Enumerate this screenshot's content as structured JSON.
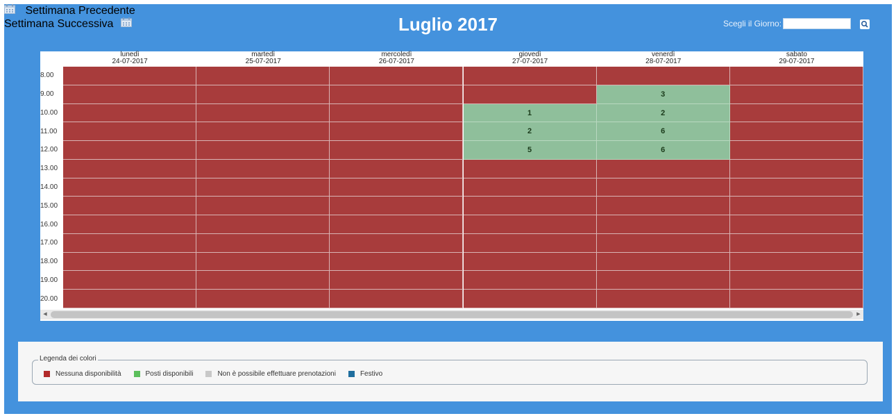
{
  "header": {
    "prev_label": "Settimana Precedente",
    "next_label": "Settimana Successiva",
    "month_title": "Luglio 2017",
    "day_picker_label": "Scegli il Giorno:",
    "day_picker_value": ""
  },
  "calendar": {
    "days": [
      {
        "name": "lunedì",
        "date": "24-07-2017"
      },
      {
        "name": "martedì",
        "date": "25-07-2017"
      },
      {
        "name": "mercoledì",
        "date": "26-07-2017"
      },
      {
        "name": "giovedì",
        "date": "27-07-2017"
      },
      {
        "name": "venerdì",
        "date": "28-07-2017"
      },
      {
        "name": "sabato",
        "date": "29-07-2017"
      }
    ],
    "hours": [
      "8.00",
      "9.00",
      "10.00",
      "11.00",
      "12.00",
      "13.00",
      "14.00",
      "15.00",
      "16.00",
      "17.00",
      "18.00",
      "19.00",
      "20.00"
    ],
    "cells": [
      [
        "red",
        "red",
        "red",
        "red",
        "red",
        "red"
      ],
      [
        "red",
        "red",
        "red",
        "red",
        "green",
        "red"
      ],
      [
        "red",
        "red",
        "red",
        "green",
        "green",
        "red"
      ],
      [
        "red",
        "red",
        "red",
        "green",
        "green",
        "red"
      ],
      [
        "red",
        "red",
        "red",
        "green",
        "green",
        "red"
      ],
      [
        "red",
        "red",
        "red",
        "red",
        "red",
        "red"
      ],
      [
        "red",
        "red",
        "red",
        "red",
        "red",
        "red"
      ],
      [
        "red",
        "red",
        "red",
        "red",
        "red",
        "red"
      ],
      [
        "red",
        "red",
        "red",
        "red",
        "red",
        "red"
      ],
      [
        "red",
        "red",
        "red",
        "red",
        "red",
        "red"
      ],
      [
        "red",
        "red",
        "red",
        "red",
        "red",
        "red"
      ],
      [
        "red",
        "red",
        "red",
        "red",
        "red",
        "red"
      ],
      [
        "red",
        "red",
        "red",
        "red",
        "red",
        "red"
      ]
    ],
    "counts": [
      [
        "",
        "",
        "",
        "",
        "",
        ""
      ],
      [
        "",
        "",
        "",
        "",
        "3",
        ""
      ],
      [
        "",
        "",
        "",
        "1",
        "2",
        ""
      ],
      [
        "",
        "",
        "",
        "2",
        "6",
        ""
      ],
      [
        "",
        "",
        "",
        "5",
        "6",
        ""
      ],
      [
        "",
        "",
        "",
        "",
        "",
        ""
      ],
      [
        "",
        "",
        "",
        "",
        "",
        ""
      ],
      [
        "",
        "",
        "",
        "",
        "",
        ""
      ],
      [
        "",
        "",
        "",
        "",
        "",
        ""
      ],
      [
        "",
        "",
        "",
        "",
        "",
        ""
      ],
      [
        "",
        "",
        "",
        "",
        "",
        ""
      ],
      [
        "",
        "",
        "",
        "",
        "",
        ""
      ],
      [
        "",
        "",
        "",
        "",
        "",
        ""
      ]
    ]
  },
  "legend": {
    "title": "Legenda dei colori",
    "items": [
      {
        "label": "Nessuna disponibilità",
        "color": "#b22a2a"
      },
      {
        "label": "Posti disponibili",
        "color": "#5cbf5c"
      },
      {
        "label": "Non è possibile effettuare prenotazioni",
        "color": "#c8c8c8"
      },
      {
        "label": "Festivo",
        "color": "#1f6e9e"
      }
    ]
  },
  "icons": {
    "prev": "calendar-icon",
    "next": "calendar-icon",
    "search": "search-icon",
    "scroll_left": "arrow-left-icon",
    "scroll_right": "arrow-right-icon"
  }
}
